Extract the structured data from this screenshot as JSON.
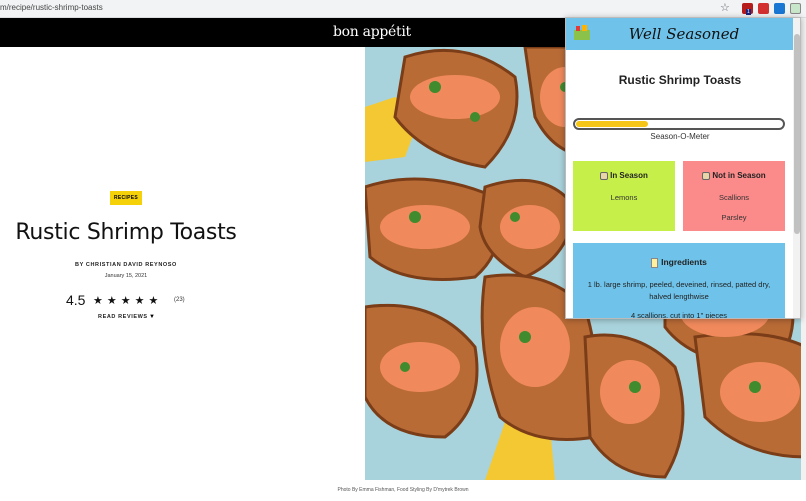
{
  "browser": {
    "url": "m/recipe/rustic-shrimp-toasts"
  },
  "site": {
    "logo": "bon appétit"
  },
  "article": {
    "tag": "RECIPES",
    "title": "Rustic Shrimp Toasts",
    "byline": "BY CHRISTIAN DAVID REYNOSO",
    "date": "January 15, 2021",
    "rating": "4.5",
    "stars": "★★★★★",
    "review_count": "(23)",
    "read_reviews": "READ REVIEWS",
    "photo_caption": "Photo By Emma Fishman, Food Styling By D'mytrek Brown"
  },
  "popup": {
    "brand": "Well Seasoned",
    "recipe_title": "Rustic Shrimp Toasts",
    "meter_label": "Season-O-Meter",
    "meter_level": 0.35,
    "in_season": {
      "label": "In Season",
      "items": [
        "Lemons"
      ]
    },
    "not_in_season": {
      "label": "Not in Season",
      "items": [
        "Scallions",
        "Parsley"
      ]
    },
    "ingredients": {
      "label": "Ingredients",
      "items": [
        "1 lb. large shrimp, peeled, deveined, rinsed, patted dry, halved lengthwise",
        "4 scallions, cut into 1\" pieces"
      ]
    }
  },
  "colors": {
    "header_bg": "#000000",
    "tag_bg": "#f5d10a",
    "popup_header": "#6fc3ea",
    "in_season_bg": "#c7ef4a",
    "not_in_season_bg": "#fb8a8a",
    "meter_fill": "#f5c518"
  },
  "icons": [
    "star-icon",
    "extension-icon",
    "caret-down-icon",
    "thumbs-up-icon",
    "thumbs-down-icon",
    "ingredients-icon",
    "app-logo-icon"
  ]
}
